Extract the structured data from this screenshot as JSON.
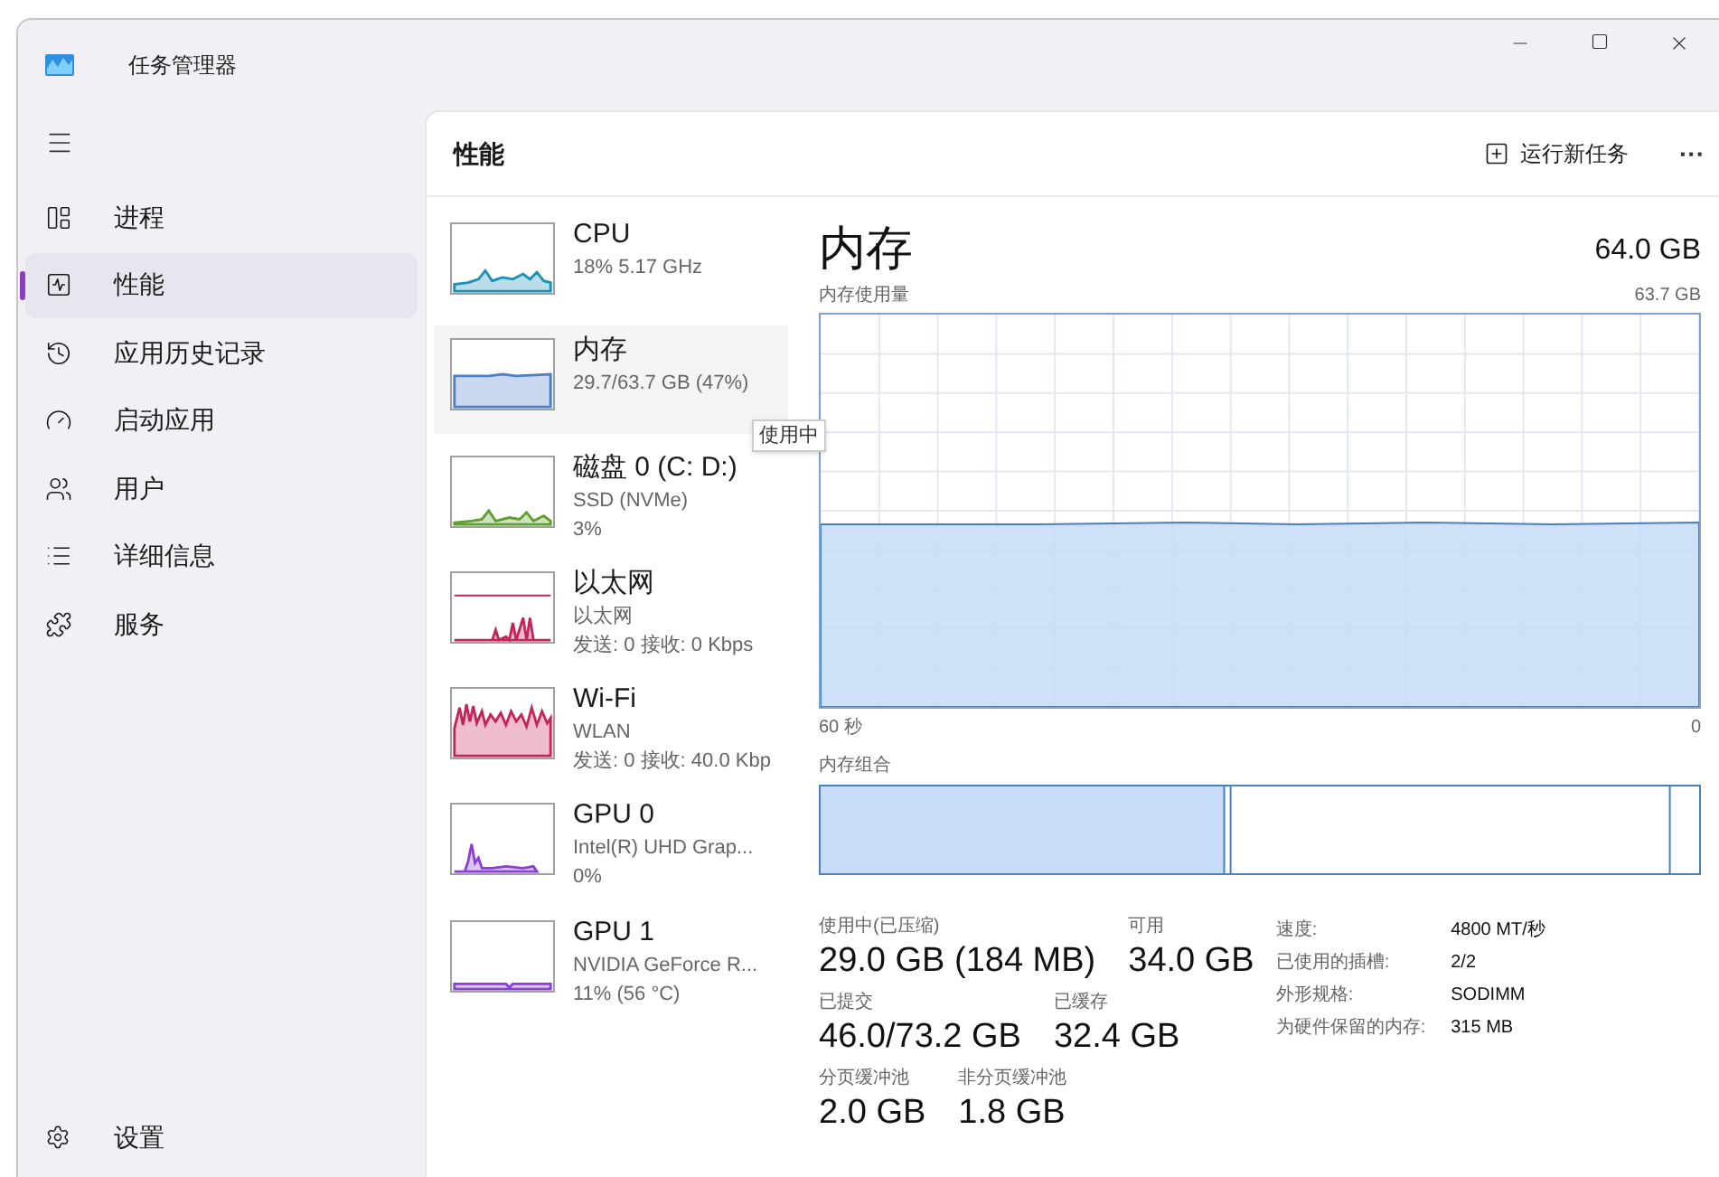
{
  "window": {
    "title": "任务管理器"
  },
  "sidebar": {
    "items": [
      {
        "kind": "processes",
        "label": "进程",
        "selected": false
      },
      {
        "kind": "performance",
        "label": "性能",
        "selected": true
      },
      {
        "kind": "history",
        "label": "应用历史记录",
        "selected": false
      },
      {
        "kind": "startup",
        "label": "启动应用",
        "selected": false
      },
      {
        "kind": "users",
        "label": "用户",
        "selected": false
      },
      {
        "kind": "details",
        "label": "详细信息",
        "selected": false
      },
      {
        "kind": "services",
        "label": "服务",
        "selected": false
      }
    ],
    "settings": "设置"
  },
  "header": {
    "title": "性能",
    "run_task": "运行新任务",
    "more": "···"
  },
  "devices": [
    {
      "kind": "spiky",
      "name": "CPU",
      "lines": [
        "18% 5.17 GHz"
      ],
      "color": "#1b8fb5",
      "selected": false
    },
    {
      "kind": "flat",
      "name": "内存",
      "lines": [
        "29.7/63.7 GB (47%)"
      ],
      "color": "#4b7fc7",
      "selected": true
    },
    {
      "kind": "low",
      "name": "磁盘 0 (C: D:)",
      "lines": [
        "SSD (NVMe)",
        "3%"
      ],
      "color": "#5ea02f",
      "selected": false
    },
    {
      "kind": "bursts",
      "name": "以太网",
      "lines": [
        "以太网",
        "发送: 0 接收: 0 Kbps"
      ],
      "color": "#c4245a",
      "selected": false
    },
    {
      "kind": "busy",
      "name": "Wi-Fi",
      "lines": [
        "WLAN",
        "发送: 0 接收: 40.0 Kbp"
      ],
      "color": "#c4245a",
      "selected": false
    },
    {
      "kind": "peak",
      "name": "GPU 0",
      "lines": [
        "Intel(R) UHD Grap...",
        "0%"
      ],
      "color": "#8a3fd6",
      "selected": false
    },
    {
      "kind": "base",
      "name": "GPU 1",
      "lines": [
        "NVIDIA GeForce R...",
        "11% (56 °C)"
      ],
      "color": "#8a3fd6",
      "selected": false
    }
  ],
  "tooltip": "使用中",
  "detail": {
    "title": "内存",
    "total": "64.0 GB",
    "usage_label": "内存使用量",
    "usage_max": "63.7 GB",
    "time_start": "60 秒",
    "time_end": "0",
    "composition_label": "内存组合",
    "stats": [
      [
        {
          "label": "使用中(已压缩)",
          "value": "29.0 GB (184 MB)"
        },
        {
          "label": "可用",
          "value": "34.0 GB"
        }
      ],
      [
        {
          "label": "已提交",
          "value": "46.0/73.2 GB"
        },
        {
          "label": "已缓存",
          "value": "32.4 GB"
        }
      ],
      [
        {
          "label": "分页缓冲池",
          "value": "2.0 GB"
        },
        {
          "label": "非分页缓冲池",
          "value": "1.8 GB"
        }
      ]
    ],
    "properties": [
      {
        "label": "速度:",
        "value": "4800 MT/秒"
      },
      {
        "label": "已使用的插槽:",
        "value": "2/2"
      },
      {
        "label": "外形规格:",
        "value": "SODIMM"
      },
      {
        "label": "为硬件保留的内存:",
        "value": "315 MB"
      }
    ]
  }
}
